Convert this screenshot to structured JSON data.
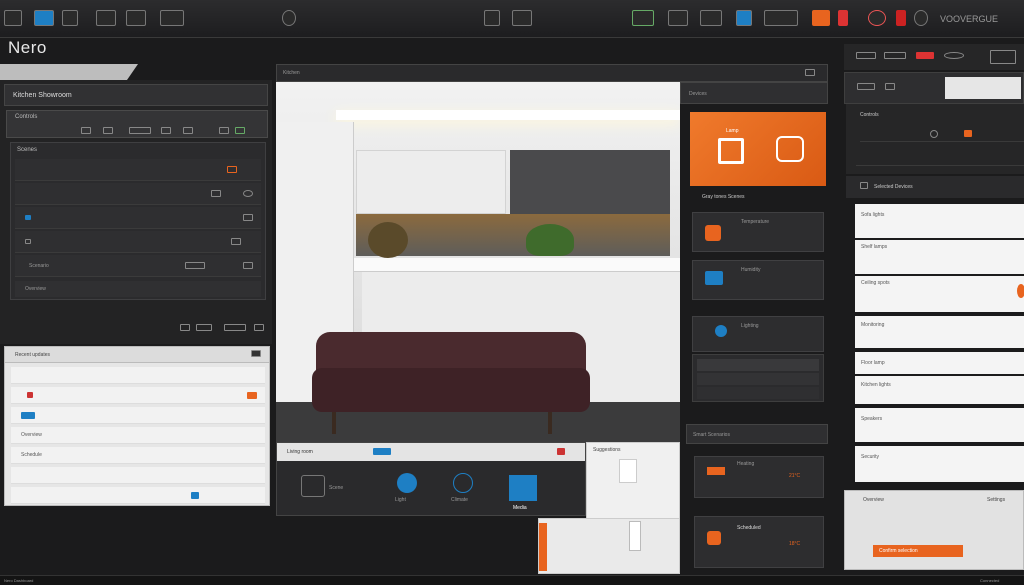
{
  "app": {
    "title": "Nero"
  },
  "topbar": {
    "brand_right": "VOOVERGUE"
  },
  "left_panel": {
    "header": "Kitchen Showroom",
    "rows": [
      "Controls",
      "Scenes",
      "",
      "",
      "",
      "",
      "Scenario",
      "Overview"
    ]
  },
  "left_table": {
    "title": "Recent updates",
    "rows": [
      "",
      "",
      "",
      "Overview",
      "Schedule",
      ""
    ]
  },
  "center": {
    "tab": "Kitchen"
  },
  "bottom_strip": {
    "label": "Living room",
    "items": [
      "Scene",
      "Light",
      "Climate",
      "Media"
    ]
  },
  "bottom_small": {
    "label": "Suggestions"
  },
  "mid_column": {
    "header": "Devices",
    "feature_label": "Lamp",
    "caption": "Gray tones Scenes",
    "section": "Smart Scenarios",
    "cards": [
      "Temperature",
      "Humidity",
      "Lighting"
    ],
    "bottom_title": "Scheduled",
    "bottom_value": "21°C",
    "bottom_value2": "18°C",
    "bottom_label": "Heating"
  },
  "right_panel": {
    "section1": "Controls",
    "section2": "Selected Devices",
    "rows": [
      "Sofa lights",
      "Shelf lamps",
      "Ceiling spots",
      "Monitoring",
      "Floor lamp",
      "Kitchen lights",
      "Speakers",
      "Security"
    ],
    "bottom_label": "Overview",
    "bottom_right": "Settings",
    "action": "Confirm selection"
  },
  "statusbar": {
    "left": "Nero Dashboard",
    "right": "Connected"
  }
}
